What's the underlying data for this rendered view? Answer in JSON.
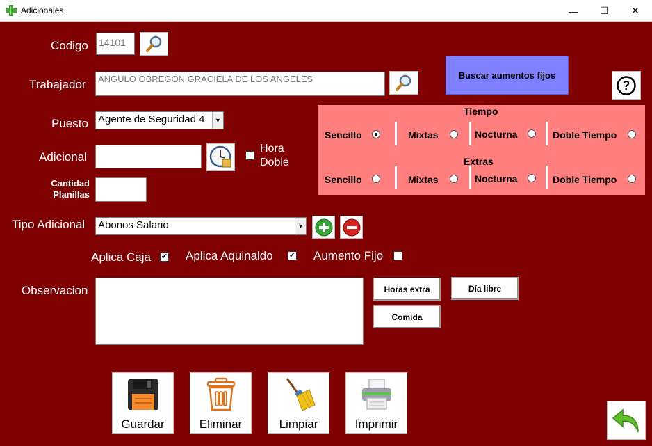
{
  "window": {
    "title": "Adicionales",
    "minimize": "—",
    "maximize": "☐",
    "close": "✕"
  },
  "form": {
    "codigo_label": "Codigo",
    "codigo_value": "14101",
    "trabajador_label": "Trabajador",
    "trabajador_value": "ANGULO OBREGON GRACIELA DE LOS ANGELES",
    "puesto_label": "Puesto",
    "puesto_value": "Agente de Seguridad 4",
    "adicional_label": "Adicional",
    "adicional_value": "",
    "hora_doble_label_1": "Hora",
    "hora_doble_label_2": "Doble",
    "cantidad_label_1": "Cantidad",
    "cantidad_label_2": "Planillas",
    "cantidad_value": "",
    "tipo_label": "Tipo Adicional",
    "tipo_value": "Abonos Salario",
    "aplica_caja_label": "Aplica Caja",
    "aplica_caja_checked": true,
    "aplica_aguinaldo_label": "Aplica Aquinaldo",
    "aplica_aguinaldo_checked": true,
    "aumento_fijo_label": "Aumento Fijo",
    "aumento_fijo_checked": false,
    "observacion_label": "Observacion",
    "observacion_value": ""
  },
  "buscar_aumentos_label": "Buscar aumentos fijos",
  "tiempo_panel": {
    "tiempo_title": "Tiempo",
    "extras_title": "Extras",
    "options": [
      "Sencillo",
      "Mixtas",
      "Nocturna",
      "Doble Tiempo"
    ],
    "tiempo_selected": "Sencillo",
    "extras_selected": ""
  },
  "quick_buttons": {
    "horas_extra": "Horas extra",
    "dia_libre": "Día libre",
    "comida": "Comida"
  },
  "actions": {
    "guardar": "Guardar",
    "eliminar": "Eliminar",
    "limpiar": "Limpiar",
    "imprimir": "Imprimir"
  },
  "colors": {
    "background": "#7f0000",
    "panel": "#ff7f7f",
    "buscar_button": "#7f7fff"
  }
}
